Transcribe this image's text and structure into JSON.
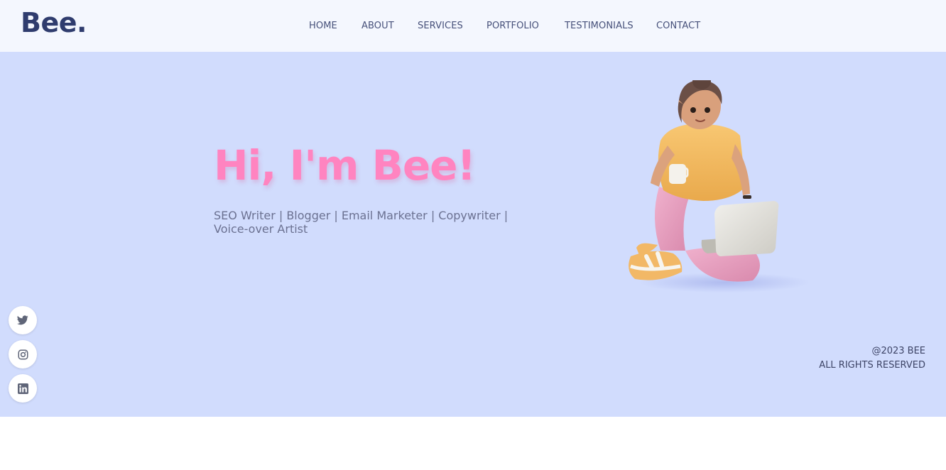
{
  "header": {
    "logo": "Bee.",
    "nav": [
      "HOME",
      "ABOUT",
      "SERVICES",
      "PORTFOLIO",
      "TESTIMONIALS",
      "CONTACT"
    ]
  },
  "hero": {
    "title": "Hi, I'm Bee!",
    "subtitle": "SEO Writer | Blogger | Email Marketer | Copywriter | Voice-over Artist",
    "illustration_icon": "person-sitting-with-laptop-and-mug"
  },
  "social": [
    {
      "name": "twitter",
      "icon": "twitter-icon"
    },
    {
      "name": "instagram",
      "icon": "instagram-icon"
    },
    {
      "name": "linkedin",
      "icon": "linkedin-icon"
    }
  ],
  "footer": {
    "copyright": "@2023 BEE",
    "rights": "ALL RIGHTS RESERVED"
  },
  "colors": {
    "header_bg": "#f4f7fe",
    "hero_bg": "#d1dcfd",
    "logo": "#2f3c6e",
    "title": "#ff84c0",
    "text": "#46507a"
  }
}
